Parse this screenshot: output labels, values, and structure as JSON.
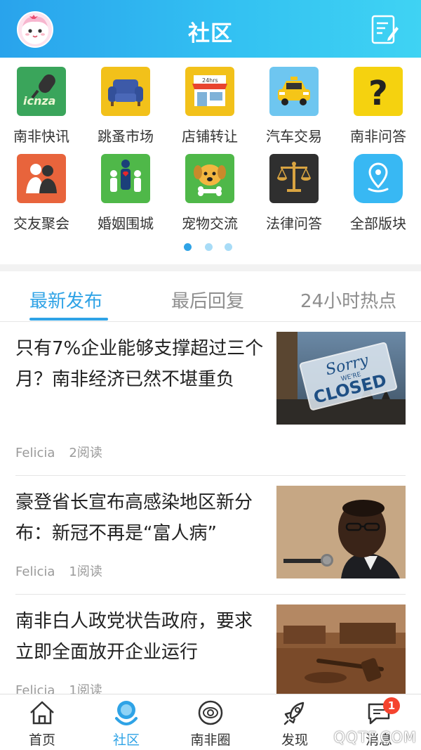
{
  "header": {
    "title": "社区",
    "avatar_icon": "cartoon-avatar-icon",
    "edit_icon": "edit-note-icon"
  },
  "grid": {
    "items": [
      {
        "label": "南非快讯",
        "icon": "microphone-icnza-icon",
        "color": "#3aa55b"
      },
      {
        "label": "跳蚤市场",
        "icon": "sofa-icon",
        "color": "#f2c11a"
      },
      {
        "label": "店铺转让",
        "icon": "shop-icon",
        "color": "#f2c11a"
      },
      {
        "label": "汽车交易",
        "icon": "taxi-icon",
        "color": "#6ec6f0"
      },
      {
        "label": "南非问答",
        "icon": "question-mark-icon",
        "color": "#f5d20f"
      },
      {
        "label": "交友聚会",
        "icon": "friends-icon",
        "color": "#e8643c"
      },
      {
        "label": "婚姻围城",
        "icon": "family-icon",
        "color": "#4fb849"
      },
      {
        "label": "宠物交流",
        "icon": "dog-icon",
        "color": "#4fb849"
      },
      {
        "label": "法律问答",
        "icon": "scales-icon",
        "color": "#2f2f2f"
      },
      {
        "label": "全部版块",
        "icon": "location-pin-icon",
        "color": "#38b8f3"
      }
    ]
  },
  "tabs": [
    {
      "label": "最新发布",
      "active": true
    },
    {
      "label": "最后回复",
      "active": false
    },
    {
      "label": "24小时热点",
      "active": false
    }
  ],
  "articles": [
    {
      "title": "只有7%企业能够支撑超过三个月？南非经济已然不堪重负",
      "author": "Felicia",
      "reads": "2阅读",
      "image": "sorry-closed-sign-image",
      "image_text_1": "Sorry",
      "image_text_2": "WE'RE",
      "image_text_3": "CLOSED"
    },
    {
      "title": "豪登省长宣布高感染地区新分布：新冠不再是“富人病”",
      "author": "Felicia",
      "reads": "1阅读",
      "image": "speaker-at-microphone-image"
    },
    {
      "title": "南非白人政党状告政府，要求立即全面放开企业运行",
      "author": "Felicia",
      "reads": "1阅读",
      "image": "courtroom-gavel-image"
    }
  ],
  "bottom_nav": [
    {
      "label": "首页",
      "icon": "home-icon",
      "active": false
    },
    {
      "label": "社区",
      "icon": "community-icon",
      "active": true
    },
    {
      "label": "南非圈",
      "icon": "planet-icon",
      "active": false
    },
    {
      "label": "发现",
      "icon": "rocket-icon",
      "active": false
    },
    {
      "label": "消息",
      "icon": "chat-bubble-icon",
      "active": false,
      "badge": "1"
    }
  ],
  "watermark": "QQTF.COM",
  "colors": {
    "accent": "#2fa3e6",
    "header_start": "#29a3ec",
    "header_end": "#3fd3f3",
    "badge": "#f5442f"
  }
}
